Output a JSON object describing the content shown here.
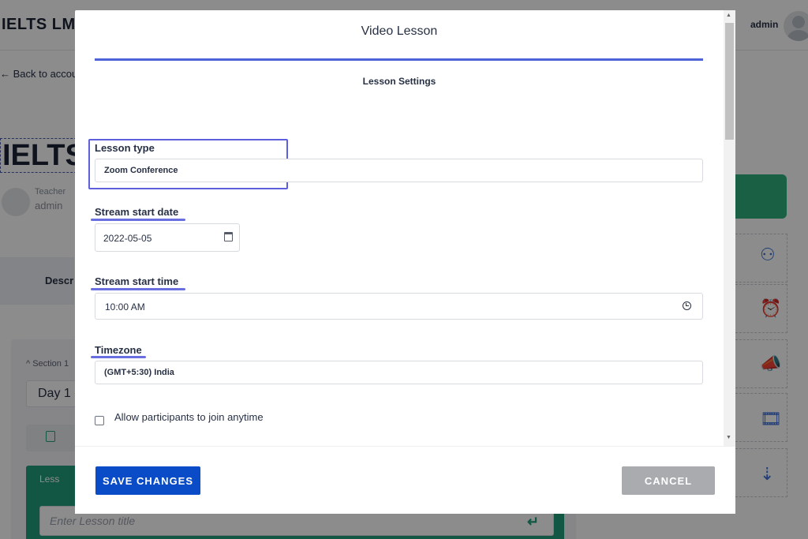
{
  "background": {
    "logo": "IELTS LMS",
    "user_name": "admin",
    "back_link": "← Back to accou",
    "course_title": "IELTS",
    "teacher_role": "Teacher",
    "teacher_name": "admin",
    "tab_description": "Descr",
    "section_label": "^ Section 1",
    "day_label": "Day 1",
    "lesson_box_label": "Less",
    "lesson_title_placeholder": "Enter Lesson title"
  },
  "modal": {
    "title": "Video Lesson",
    "section_title": "Lesson Settings",
    "lesson_type": {
      "label": "Lesson type",
      "value": "Zoom Conference"
    },
    "stream_start_date": {
      "label": "Stream start date",
      "value": "2022-05-05"
    },
    "stream_start_time": {
      "label": "Stream start time",
      "value": "10:00 AM"
    },
    "timezone": {
      "label": "Timezone",
      "value": "(GMT+5:30) India"
    },
    "allow_anytime": {
      "label": "Allow participants to join anytime",
      "checked": false
    },
    "save_label": "SAVE CHANGES",
    "cancel_label": "CANCEL"
  },
  "colors": {
    "accent": "#4e63d8",
    "highlight": "#5d5fdc",
    "primary_button": "#0a4cc7",
    "cancel_button": "#a9abae",
    "bg_green": "#1f9e7b"
  }
}
